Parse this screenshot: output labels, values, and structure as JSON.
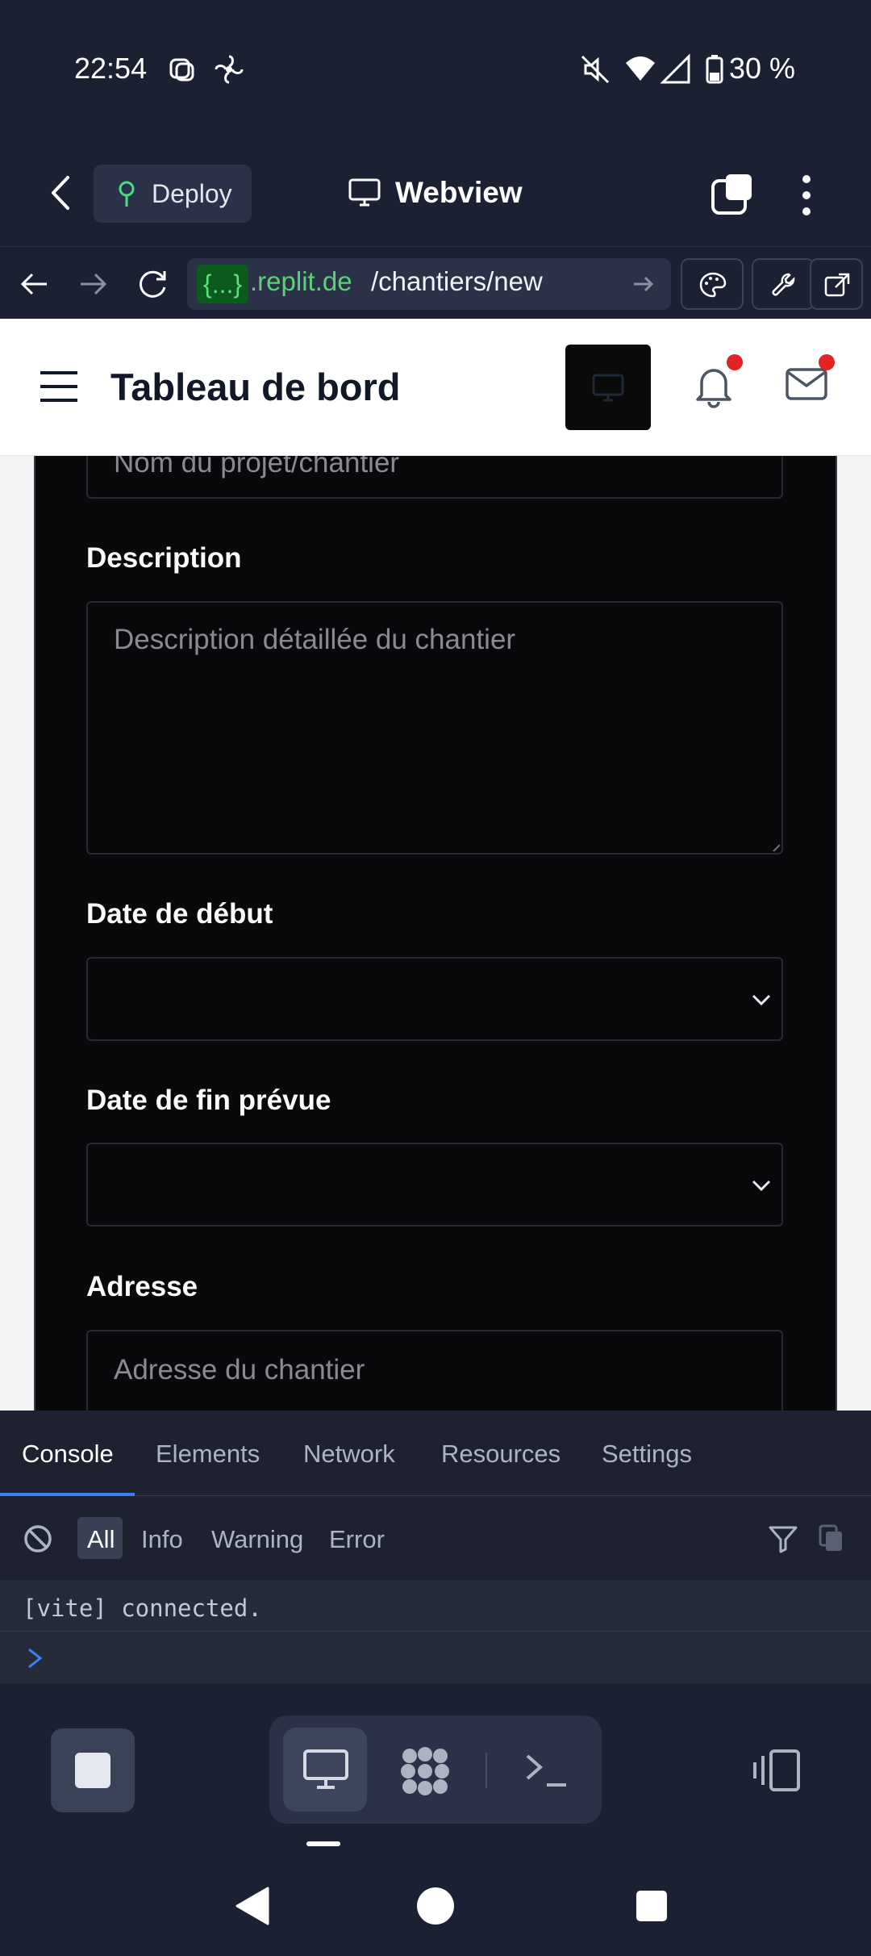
{
  "status_bar": {
    "time": "22:54",
    "battery": "30 %"
  },
  "header": {
    "deploy_label": "Deploy",
    "webview_title": "Webview"
  },
  "url_bar": {
    "badge": "{...}",
    "domain": ".replit.de",
    "path": "/chantiers/new"
  },
  "app": {
    "page_title": "Tableau de bord"
  },
  "form": {
    "name_placeholder": "Nom du projet/chantier",
    "description_label": "Description",
    "description_placeholder": "Description détaillée du chantier",
    "start_date_label": "Date de début",
    "end_date_label": "Date de fin prévue",
    "address_label": "Adresse",
    "address_placeholder": "Adresse du chantier"
  },
  "devtools": {
    "tabs": [
      "Console",
      "Elements",
      "Network",
      "Resources",
      "Settings"
    ],
    "filters": [
      "All",
      "Info",
      "Warning",
      "Error"
    ],
    "log": "[vite] connected."
  },
  "colors": {
    "chrome_bg": "#1b2133",
    "form_bg": "#09090b",
    "accent_blue": "#3b82f6",
    "notification_dot": "#e02424",
    "domain_green": "#5fd07a"
  },
  "icons": [
    "back-icon",
    "deploy-icon",
    "monitor-icon",
    "tabs-icon",
    "more-icon",
    "nav-back-icon",
    "nav-forward-icon",
    "reload-icon",
    "go-arrow-icon",
    "palette-icon",
    "wrench-icon",
    "external-link-icon",
    "hamburger-icon",
    "bell-icon",
    "mail-icon",
    "clear-icon",
    "filter-icon",
    "copy-icon",
    "stop-icon",
    "agent-icon",
    "terminal-icon",
    "layout-icon"
  ]
}
